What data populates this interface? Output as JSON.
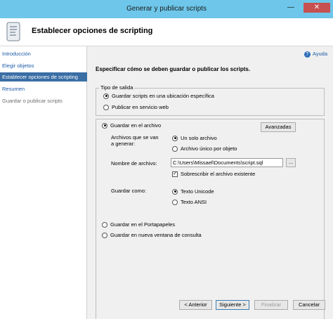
{
  "window": {
    "title": "Generar y publicar scripts",
    "minimize": "—",
    "close": "✕"
  },
  "header": {
    "title": "Establecer opciones de scripting",
    "icon": "scroll-icon"
  },
  "sidebar": {
    "items": [
      {
        "label": "Introducción",
        "state": "link"
      },
      {
        "label": "Elegir objetos",
        "state": "link"
      },
      {
        "label": "Establecer opciones de scripting",
        "state": "active"
      },
      {
        "label": "Resumen",
        "state": "link"
      },
      {
        "label": "Guardar o publicar scripts",
        "state": "disabled"
      }
    ]
  },
  "help": {
    "label": "Ayuda",
    "icon": "help-icon"
  },
  "instruction": "Especificar cómo se deben guardar o publicar los scripts.",
  "output_type": {
    "legend": "Tipo de salida",
    "option_save": "Guardar scripts en una ubicación específica",
    "option_publish": "Publicar en servicio web",
    "selected": "save"
  },
  "save_options": {
    "save_to_file": "Guardar en el archivo",
    "advanced_button": "Avanzadas",
    "files_label_line1": "Archivos que se van",
    "files_label_line2": "a generar:",
    "single_file": "Un solo archivo",
    "file_per_object": "Archivo único por objeto",
    "file_name_label": "Nombre de archivo:",
    "file_name_value": "C:\\Users\\Missael\\Documents\\script.sql",
    "browse_button": "...",
    "overwrite_label": "Sobrescribir el archivo existente",
    "overwrite_checked": true,
    "encoding_label": "Guardar como:",
    "encoding_unicode": "Texto Unicode",
    "encoding_ansi": "Texto ANSI",
    "save_to_clipboard": "Guardar en el Portapapeles",
    "save_to_query_window": "Guardar en nueva ventana de consulta"
  },
  "footer": {
    "back": "< Anterior",
    "next": "Siguiente >",
    "finish": "Finalizar",
    "cancel": "Cancelar"
  },
  "colors": {
    "titlebar": "#6ec7ea",
    "accent": "#3a6ea5",
    "link": "#1a5aa8"
  }
}
